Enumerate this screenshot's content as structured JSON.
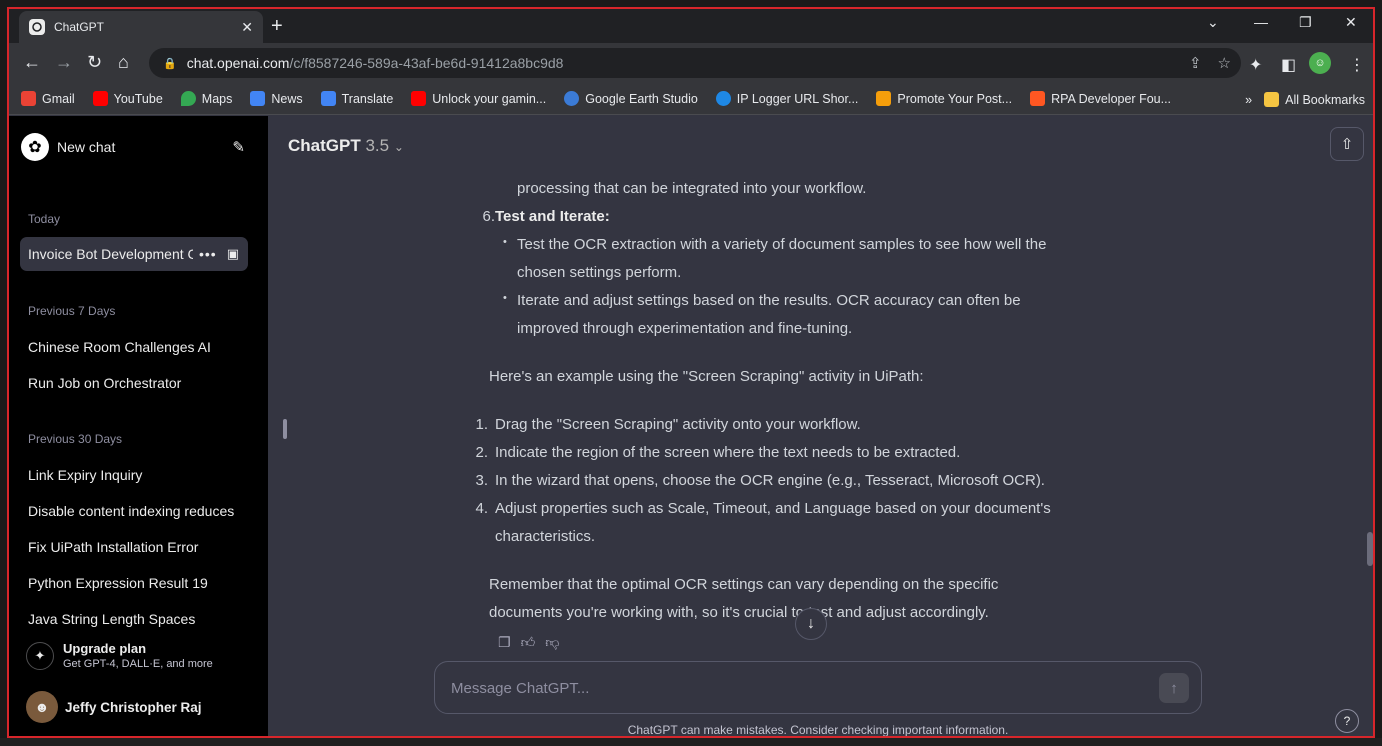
{
  "browser": {
    "tab_title": "ChatGPT",
    "url_host": "chat.openai.com",
    "url_path": "/c/f8587246-589a-43af-be6d-91412a8bc9d8",
    "bookmarks": [
      {
        "label": "Gmail",
        "color": "#ea4335"
      },
      {
        "label": "YouTube",
        "color": "#ff0000"
      },
      {
        "label": "Maps",
        "color": "#34a853"
      },
      {
        "label": "News",
        "color": "#4285f4"
      },
      {
        "label": "Translate",
        "color": "#4285f4"
      },
      {
        "label": "Unlock your gamin...",
        "color": "#ff0000"
      },
      {
        "label": "Google Earth Studio",
        "color": "#3b7bd6"
      },
      {
        "label": "IP Logger URL Shor...",
        "color": "#1e88e5"
      },
      {
        "label": "Promote Your Post...",
        "color": "#f59e0b"
      },
      {
        "label": "RPA Developer Fou...",
        "color": "#ff5722"
      }
    ],
    "all_bookmarks": "All Bookmarks"
  },
  "sidebar": {
    "new_chat": "New chat",
    "today_label": "Today",
    "active_chat": "Invoice Bot Development Challenges",
    "prev7_label": "Previous 7 Days",
    "prev7": [
      "Chinese Room Challenges AI",
      "Run Job on Orchestrator"
    ],
    "prev30_label": "Previous 30 Days",
    "prev30": [
      "Link Expiry Inquiry",
      "Disable content indexing reduces",
      "Fix UiPath Installation Error",
      "Python Expression Result 19",
      "Java String Length Spaces"
    ],
    "upgrade_title": "Upgrade plan",
    "upgrade_sub": "Get GPT-4, DALL·E, and more",
    "user_name": "Jeffy Christopher Raj"
  },
  "main": {
    "model_name": "ChatGPT",
    "model_version": "3.5",
    "message": {
      "l0": "processing that can be integrated into your workflow.",
      "n6": "6.",
      "h6": "Test and Iterate:",
      "b1a": "Test the OCR extraction with a variety of document samples to see how well the",
      "b1b": "chosen settings perform.",
      "b2a": "Iterate and adjust settings based on the results. OCR accuracy can often be",
      "b2b": "improved through experimentation and fine-tuning.",
      "p1": "Here's an example using the \"Screen Scraping\" activity in UiPath:",
      "s1": "Drag the \"Screen Scraping\" activity onto your workflow.",
      "s2": "Indicate the region of the screen where the text needs to be extracted.",
      "s3": "In the wizard that opens, choose the OCR engine (e.g., Tesseract, Microsoft OCR).",
      "s4a": "Adjust properties such as Scale, Timeout, and Language based on your document's",
      "s4b": "characteristics.",
      "p2a": "Remember that the optimal OCR settings can vary depending on the specific",
      "p2b": "documents you're working with, so it's crucial to test and adjust accordingly."
    },
    "input_placeholder": "Message ChatGPT...",
    "disclaimer": "ChatGPT can make mistakes. Consider checking important information.",
    "help": "?"
  }
}
